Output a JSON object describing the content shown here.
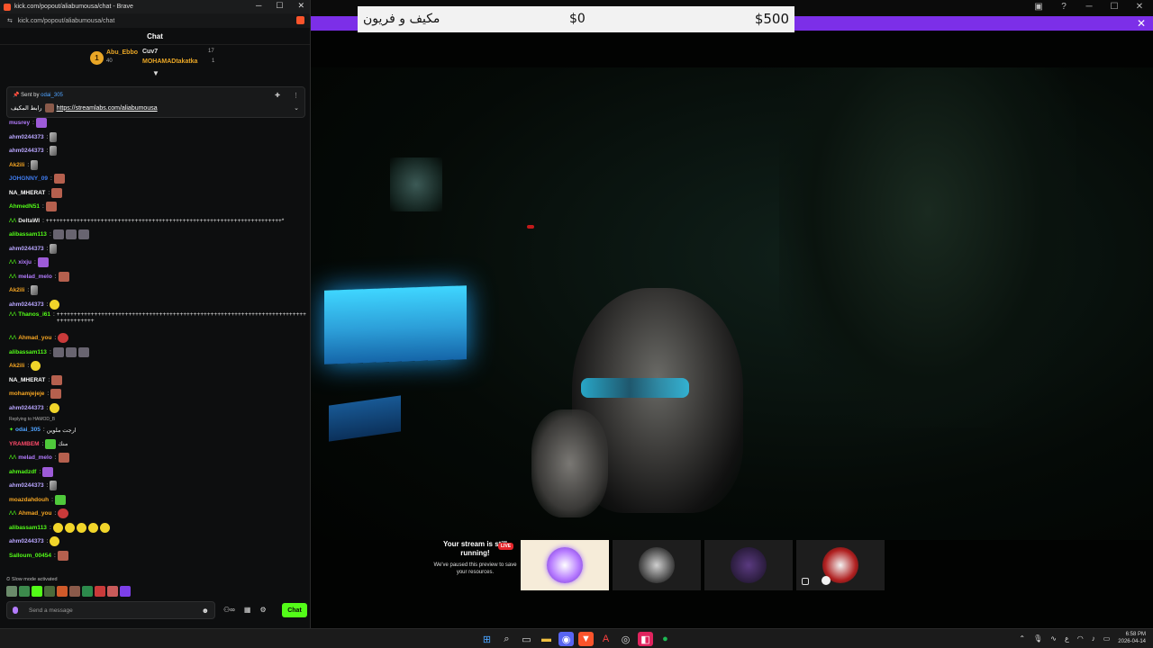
{
  "browser": {
    "window_title": "kick.com/popout/aliabumousa/chat - Brave",
    "url": "kick.com/popout/aliabumousa/chat",
    "controls": {
      "minimize": "─",
      "maximize": "☐",
      "close": "✕"
    }
  },
  "chat": {
    "header": "Chat",
    "leaderboard": {
      "rank": "1",
      "first": {
        "name": "Abu_Ebbo",
        "score": "40"
      },
      "second": {
        "name": "Cuv7",
        "score": "17"
      },
      "third": {
        "name": "MOHAMADtakatka",
        "score": "1"
      }
    },
    "pinned": {
      "sent_by_label": "Sent by",
      "sender": "odai_305",
      "text": "رابط المكيف",
      "link": "https://streamlabs.com/aliabumousa"
    },
    "messages": [
      {
        "user": "musrey",
        "color": "#b47cff",
        "text": "",
        "badge": "",
        "emotes": [
          "e-pur"
        ]
      },
      {
        "user": "ahm0244373",
        "color": "#b9a6ff",
        "text": "",
        "badge": "",
        "emotes": [
          "e-kn"
        ]
      },
      {
        "user": "ahm0244373",
        "color": "#b9a6ff",
        "text": "",
        "badge": "",
        "emotes": [
          "e-kn"
        ]
      },
      {
        "user": "Ak2ili",
        "color": "#f6a623",
        "text": "",
        "badge": "",
        "emotes": [
          "e-kn"
        ]
      },
      {
        "user": "JOHGNNY_09",
        "color": "#3f7cf0",
        "text": "",
        "badge": "",
        "emotes": [
          "e-face"
        ]
      },
      {
        "user": "NA_MHERAT",
        "color": "#ffffff",
        "text": "",
        "badge": "",
        "emotes": [
          "e-face"
        ]
      },
      {
        "user": "AhmedN51",
        "color": "#53fc18",
        "text": "",
        "badge": "",
        "emotes": [
          "e-face"
        ]
      },
      {
        "user": "DeltaWI",
        "color": "#e6e6e6",
        "text": "+++++++++++++++++++++++++++++++++++++++++++++++++++++++++++++++++++++*",
        "badge": "ᐱᐱ",
        "emotes": []
      },
      {
        "user": "alibassam113",
        "color": "#53fc18",
        "text": "",
        "badge": "",
        "emotes": [
          "e-gray",
          "e-gray",
          "e-gray"
        ]
      },
      {
        "user": "ahm0244373",
        "color": "#b9a6ff",
        "text": "",
        "badge": "",
        "emotes": [
          "e-kn"
        ]
      },
      {
        "user": "xixju",
        "color": "#b47cff",
        "text": "",
        "badge": "ᐱᐱ",
        "emotes": [
          "e-pur"
        ]
      },
      {
        "user": "melad_melo",
        "color": "#b47cff",
        "text": "",
        "badge": "ᐱᐱ",
        "emotes": [
          "e-face"
        ]
      },
      {
        "user": "Ak2ili",
        "color": "#f6a623",
        "text": "",
        "badge": "",
        "emotes": [
          "e-kn"
        ]
      },
      {
        "user": "ahm0244373",
        "color": "#b9a6ff",
        "text": "",
        "badge": "",
        "emotes": [
          "e-yel"
        ]
      },
      {
        "user": "Thanos_i61",
        "color": "#53fc18",
        "text": "+++++++++++++++++++++++++++++++++++++++++++++++++++++++++++++++++++++++++++++++++++++++++ +++++++++++",
        "badge": "ᐱᐱ",
        "emotes": [],
        "tall": true
      },
      {
        "user": "Ahmad_you",
        "color": "#f6a623",
        "text": "",
        "badge": "ᐱᐱ",
        "emotes": [
          "e-red"
        ]
      },
      {
        "user": "alibassam113",
        "color": "#53fc18",
        "text": "",
        "badge": "",
        "emotes": [
          "e-gray",
          "e-gray",
          "e-gray"
        ]
      },
      {
        "user": "Ak2ili",
        "color": "#f6a623",
        "text": "",
        "badge": "",
        "emotes": [
          "e-yel"
        ]
      },
      {
        "user": "NA_MHERAT",
        "color": "#ffffff",
        "text": "",
        "badge": "",
        "emotes": [
          "e-face"
        ]
      },
      {
        "user": "mohamjejeje",
        "color": "#f6a623",
        "text": "",
        "badge": "",
        "emotes": [
          "e-face"
        ]
      },
      {
        "user": "ahm0244373",
        "color": "#b9a6ff",
        "text": "",
        "badge": "",
        "emotes": [
          "e-yel"
        ]
      }
    ],
    "reply_label": "Replying to HAMOD_B",
    "messages2": [
      {
        "user": "odai_305",
        "color": "#4fa3ff",
        "text": "ارجت ملوين",
        "badge": "✦",
        "emotes": []
      },
      {
        "user": "YRAMBEM",
        "color": "#ff4a6a",
        "text": "منك",
        "badge": "",
        "emotes": [
          "e-grn"
        ]
      },
      {
        "user": "melad_melo",
        "color": "#b47cff",
        "text": "",
        "badge": "ᐱᐱ",
        "emotes": [
          "e-face"
        ]
      },
      {
        "user": "ahmadzdf",
        "color": "#53fc18",
        "text": "",
        "badge": "",
        "emotes": [
          "e-pur"
        ]
      },
      {
        "user": "ahm0244373",
        "color": "#b9a6ff",
        "text": "",
        "badge": "",
        "emotes": [
          "e-kn"
        ]
      },
      {
        "user": "moazdahdouh",
        "color": "#f6a623",
        "text": "",
        "badge": "",
        "emotes": [
          "e-grn"
        ]
      },
      {
        "user": "Ahmad_you",
        "color": "#f6a623",
        "text": "",
        "badge": "ᐱᐱ",
        "emotes": [
          "e-red"
        ]
      },
      {
        "user": "alibassam113",
        "color": "#53fc18",
        "text": "",
        "badge": "",
        "emotes": [
          "e-yel",
          "e-yel",
          "e-yel",
          "e-yel",
          "e-yel"
        ]
      },
      {
        "user": "ahm0244373",
        "color": "#b9a6ff",
        "text": "",
        "badge": "",
        "emotes": [
          "e-yel"
        ]
      },
      {
        "user": "Salloum_00454",
        "color": "#53fc18",
        "text": "",
        "badge": "",
        "emotes": [
          "e-face"
        ]
      }
    ],
    "slow_mode": "Slow mode activated",
    "input_placeholder": "Send a message",
    "send_button": "Chat",
    "accent": "#53fc18"
  },
  "stream": {
    "goal": {
      "item": "مكيف و فريون",
      "current": "$0",
      "target": "$500"
    },
    "paused_title": "Your stream is still running!",
    "paused_sub": "We've paused this preview to save your resources.",
    "live_badge": "LIVE",
    "accent": "#7c2fe8"
  },
  "taskbar": {
    "time": "6:58 PM",
    "date": "2026-04-14",
    "lang": "ع"
  }
}
